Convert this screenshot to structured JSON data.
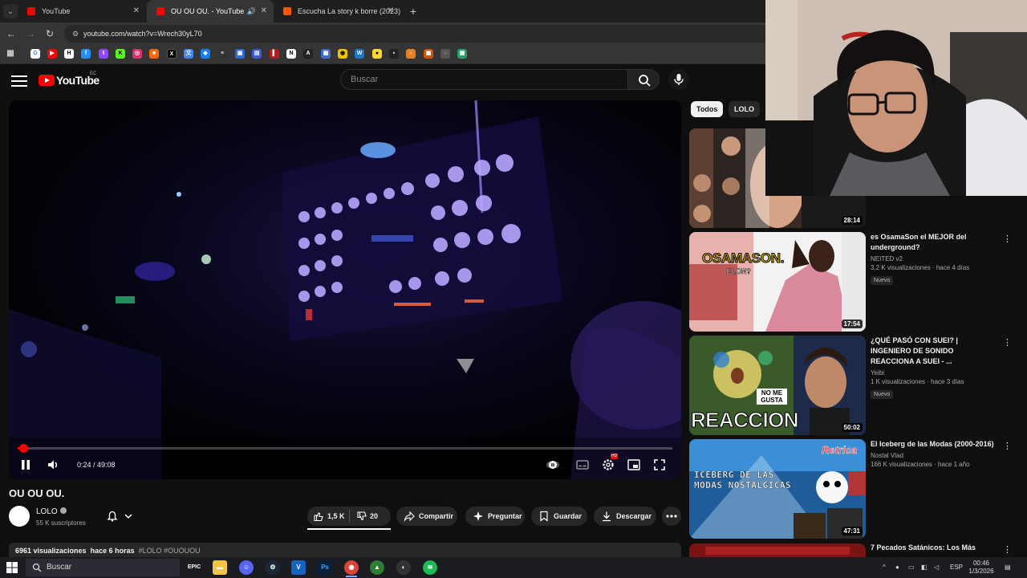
{
  "browser": {
    "tabs": [
      {
        "title": "YouTube",
        "active": false,
        "fav_color": "#ff0000"
      },
      {
        "title": "OU OU OU. - YouTube",
        "active": true,
        "fav_color": "#ff0000"
      },
      {
        "title": "Escucha La story k borre (2023)",
        "active": false,
        "fav_color": "#ff5500"
      }
    ],
    "url": "youtube.com/watch?v=Wrech30yL70"
  },
  "youtube": {
    "logo_text": "YouTube",
    "region": "EC",
    "search_placeholder": "Buscar"
  },
  "player": {
    "time": "0:24 / 49:08",
    "progress_fraction": 0.008,
    "hd_badge": "HD"
  },
  "video": {
    "title": "OU OU OU.",
    "channel": "LOLO",
    "subscribers": "55 K suscriptores",
    "likes": "1,5 K",
    "dislikes": "20",
    "share": "Compartir",
    "ask": "Preguntar",
    "save": "Guardar",
    "download": "Descargar",
    "views": "6961 visualizaciones",
    "age": "hace 6 horas",
    "tags": "#LOLO #OUOUOU"
  },
  "sidebar": {
    "chips": [
      "Todos",
      "LOLO"
    ],
    "videos": [
      {
        "title": "",
        "channel": "",
        "meta": "",
        "badge": "",
        "duration": "28:14"
      },
      {
        "title": "es OsamaSon el MEJOR del underground?",
        "channel": "NEITED v2",
        "meta": "3,2 K visualizaciones · hace 4 días",
        "badge": "Nuevo",
        "duration": "17:54",
        "thumb_text": "OSAMASON.",
        "thumb_sub": "CLON?"
      },
      {
        "title": "¿QUÉ PASÓ CON SUEI? | INGENIERO DE SONIDO REACCIONA A SUEI - ...",
        "channel": "Yeibi",
        "meta": "1 K visualizaciones · hace 3 días",
        "badge": "Nuevo",
        "duration": "50:02",
        "thumb_text": "REACCION",
        "thumb_sub": "NO ME GUSTA"
      },
      {
        "title": "El Iceberg de las Modas (2000-2016)",
        "channel": "Nostal Vlad",
        "meta": "166 K visualizaciones · hace 1 año",
        "badge": "",
        "duration": "47:31",
        "thumb_text": "ICEBERG DE LAS MODAS NOSTALGICAS",
        "thumb_sub": "Retrica"
      },
      {
        "title": "7 Pecados Satánicos: Los Más",
        "channel": "",
        "meta": "",
        "badge": "",
        "duration": ""
      }
    ]
  },
  "taskbar": {
    "search": "Buscar",
    "lang": "ESP",
    "time": "00:46",
    "date": "1/3/2026"
  }
}
